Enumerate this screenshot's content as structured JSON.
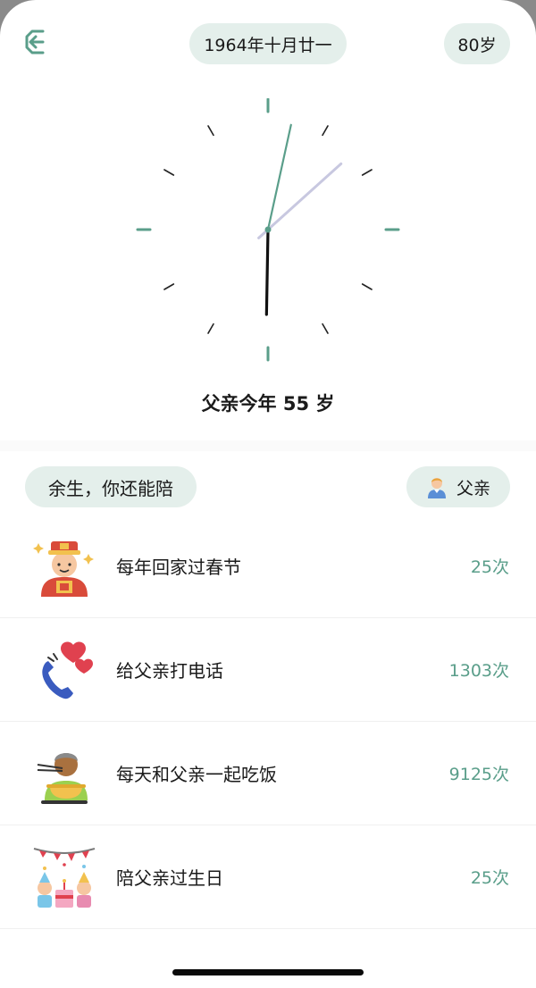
{
  "header": {
    "lunar_birth_date": "1964年十月廿一",
    "age_limit": "80岁"
  },
  "clock": {
    "hour": 6,
    "minute": 2,
    "second": 4,
    "hand_colors": {
      "hour": "#111111",
      "minute": "#5a9e8a",
      "second": "#c8c8e0"
    },
    "accent": "#5a9e8a"
  },
  "age_title": "父亲今年 55 岁",
  "section": {
    "remain_label": "余生，你还能陪",
    "person_label": "父亲",
    "person_icon": "man-avatar-icon"
  },
  "activities": [
    {
      "label": "每年回家过春节",
      "count": "25次",
      "icon": "god-of-wealth-icon"
    },
    {
      "label": "给父亲打电话",
      "count": "1303次",
      "icon": "phone-hearts-icon"
    },
    {
      "label": "每天和父亲一起吃饭",
      "count": "9125次",
      "icon": "eating-noodles-icon"
    },
    {
      "label": "陪父亲过生日",
      "count": "25次",
      "icon": "birthday-party-icon"
    }
  ]
}
